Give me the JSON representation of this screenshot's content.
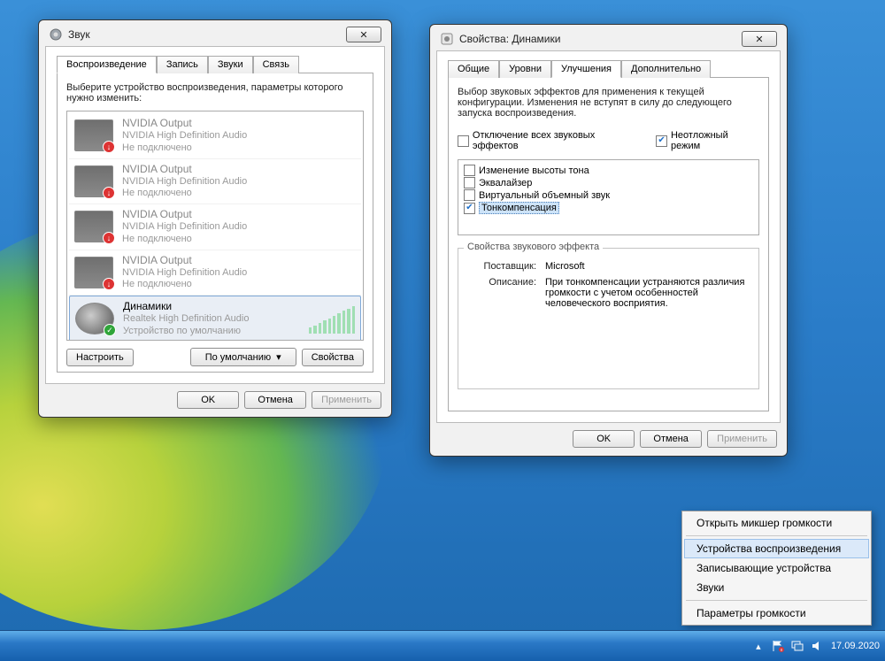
{
  "sound_window": {
    "title": "Звук",
    "tabs": [
      "Воспроизведение",
      "Запись",
      "Звуки",
      "Связь"
    ],
    "active_tab": 0,
    "instruction": "Выберите устройство воспроизведения, параметры которого нужно изменить:",
    "devices": [
      {
        "name": "NVIDIA Output",
        "sub": "NVIDIA High Definition Audio",
        "status": "Не подключено",
        "state": "disconnected"
      },
      {
        "name": "NVIDIA Output",
        "sub": "NVIDIA High Definition Audio",
        "status": "Не подключено",
        "state": "disconnected"
      },
      {
        "name": "NVIDIA Output",
        "sub": "NVIDIA High Definition Audio",
        "status": "Не подключено",
        "state": "disconnected"
      },
      {
        "name": "NVIDIA Output",
        "sub": "NVIDIA High Definition Audio",
        "status": "Не подключено",
        "state": "disconnected"
      },
      {
        "name": "Динамики",
        "sub": "Realtek High Definition Audio",
        "status": "Устройство по умолчанию",
        "state": "default"
      }
    ],
    "btn_configure": "Настроить",
    "btn_default": "По умолчанию",
    "btn_properties": "Свойства",
    "btn_ok": "OK",
    "btn_cancel": "Отмена",
    "btn_apply": "Применить"
  },
  "props_window": {
    "title": "Свойства: Динамики",
    "tabs": [
      "Общие",
      "Уровни",
      "Улучшения",
      "Дополнительно"
    ],
    "active_tab": 2,
    "intro": "Выбор звуковых эффектов для применения к текущей конфигурации. Изменения не вступят в силу до следующего запуска воспроизведения.",
    "cb_disable_all": "Отключение всех звуковых эффектов",
    "cb_urgent": "Неотложный режим",
    "enhancements": [
      {
        "label": "Изменение высоты тона",
        "checked": false
      },
      {
        "label": "Эквалайзер",
        "checked": false
      },
      {
        "label": "Виртуальный объемный звук",
        "checked": false
      },
      {
        "label": "Тонкомпенсация",
        "checked": true
      }
    ],
    "effect_group": "Свойства звукового эффекта",
    "vendor_label": "Поставщик:",
    "vendor": "Microsoft",
    "desc_label": "Описание:",
    "desc": "При тонкомпенсации устраняются различия громкости с учетом особенностей человеческого восприятия.",
    "btn_ok": "OK",
    "btn_cancel": "Отмена",
    "btn_apply": "Применить"
  },
  "context_menu": {
    "items": [
      "Открыть микшер громкости",
      "Устройства воспроизведения",
      "Записывающие устройства",
      "Звуки",
      "Параметры громкости"
    ],
    "selected": 1
  },
  "taskbar": {
    "date": "17.09.2020"
  }
}
